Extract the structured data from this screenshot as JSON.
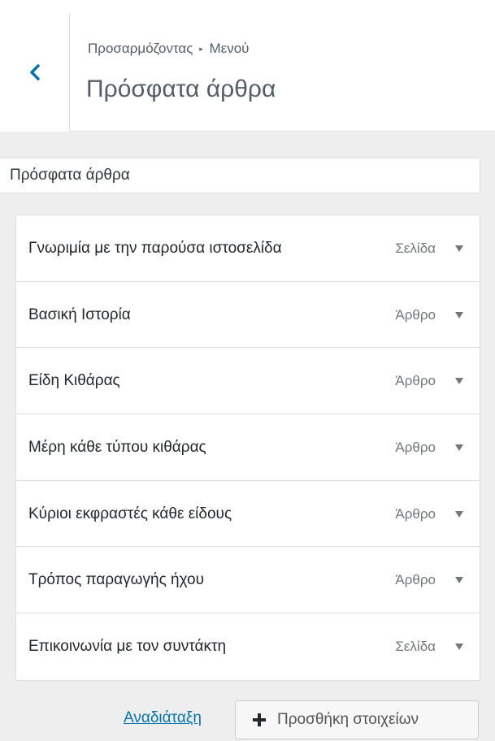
{
  "header": {
    "breadcrumb_parent": "Προσαρμόζοντας",
    "breadcrumb_sep": "▸",
    "breadcrumb_current": "Μενού",
    "title": "Πρόσφατα άρθρα"
  },
  "menu_name": {
    "value": "Πρόσφατα άρθρα"
  },
  "menu_items": [
    {
      "label": "Γνωριμία με την παρούσα ιστοσελίδα",
      "type": "Σελίδα"
    },
    {
      "label": "Βασική Ιστορία",
      "type": "Άρθρο"
    },
    {
      "label": "Είδη Κιθάρας",
      "type": "Άρθρο"
    },
    {
      "label": "Μέρη κάθε τύπου κιθάρας",
      "type": "Άρθρο"
    },
    {
      "label": "Κύριοι εκφραστές κάθε είδους",
      "type": "Άρθρο"
    },
    {
      "label": "Τρόπος παραγωγής ήχου",
      "type": "Άρθρο"
    },
    {
      "label": "Επικοινωνία με τον συντάκτη",
      "type": "Σελίδα"
    }
  ],
  "actions": {
    "reorder_label": "Αναδιάταξη",
    "add_items_label": "Προσθήκη στοιχείων"
  },
  "icons": {
    "back": "chevron-left-icon",
    "toggle": "triangle-down-icon",
    "add": "plus-icon"
  },
  "colors": {
    "accent": "#0073aa",
    "panel_bg": "#eeeeee"
  }
}
